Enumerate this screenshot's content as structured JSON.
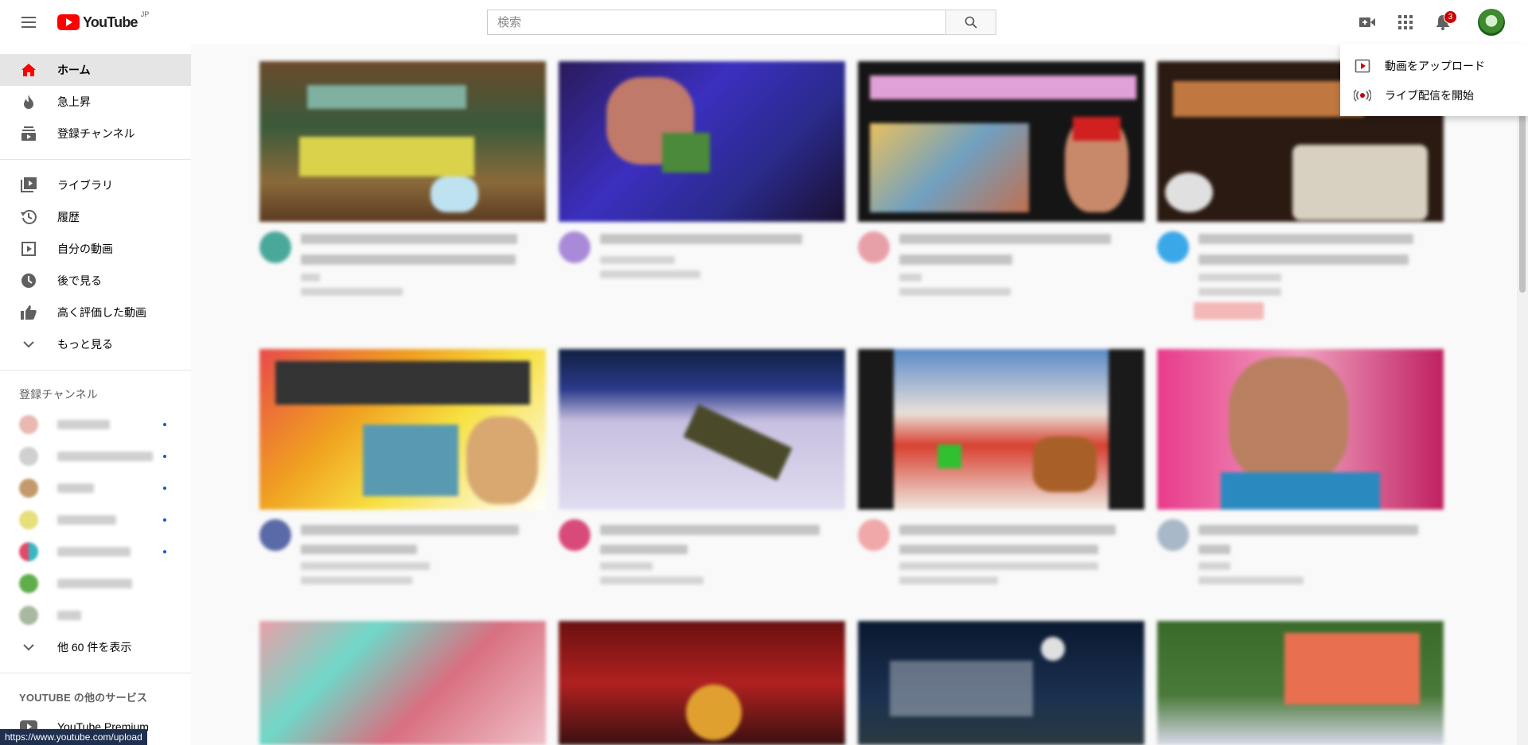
{
  "topbar": {
    "logo_text": "YouTube",
    "logo_region": "JP",
    "search_placeholder": "検索",
    "notification_count": "3"
  },
  "upload_menu": {
    "items": [
      {
        "label": "動画をアップロード",
        "icon": "upload-video-icon"
      },
      {
        "label": "ライブ配信を開始",
        "icon": "go-live-icon"
      }
    ]
  },
  "sidebar": {
    "main": [
      {
        "label": "ホーム",
        "icon": "home-icon",
        "active": true
      },
      {
        "label": "急上昇",
        "icon": "trending-icon"
      },
      {
        "label": "登録チャンネル",
        "icon": "subscriptions-icon"
      }
    ],
    "library": [
      {
        "label": "ライブラリ",
        "icon": "library-icon"
      },
      {
        "label": "履歴",
        "icon": "history-icon"
      },
      {
        "label": "自分の動画",
        "icon": "your-videos-icon"
      },
      {
        "label": "後で見る",
        "icon": "watch-later-icon"
      },
      {
        "label": "高く評価した動画",
        "icon": "liked-videos-icon"
      },
      {
        "label": "もっと見る",
        "icon": "chevron-down-icon"
      }
    ],
    "subscriptions_title": "登録チャンネル",
    "show_more": "他 60 件を表示",
    "services_title": "YOUTUBE の他のサービス",
    "services": [
      {
        "label": "YouTube Premium",
        "icon": "youtube-premium-icon"
      }
    ]
  },
  "status_url": "https://www.youtube.com/upload",
  "colors": {
    "brand_red": "#ff0000",
    "badge_red": "#cc0000",
    "new_dot_blue": "#065fd4"
  }
}
